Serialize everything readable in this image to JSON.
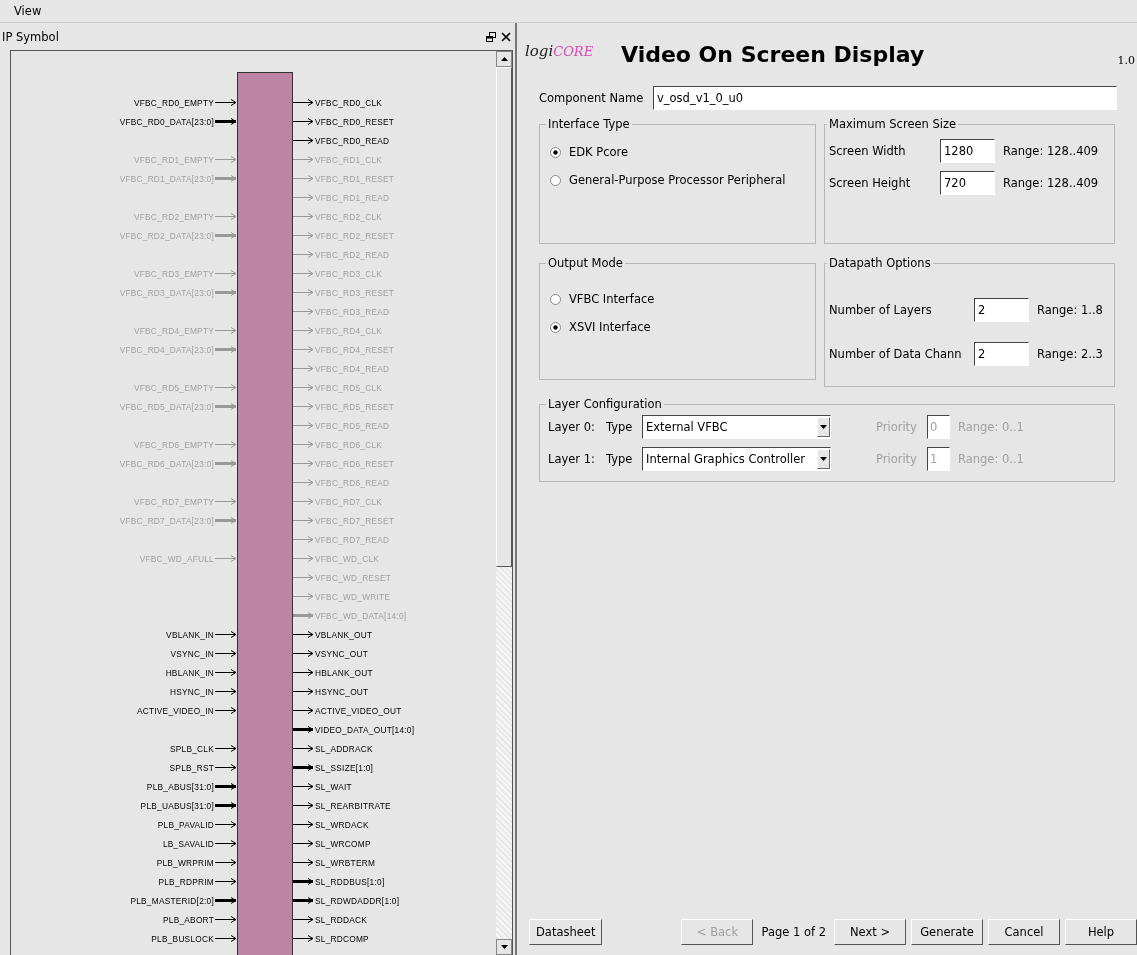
{
  "menu": [
    {
      "label": "View"
    }
  ],
  "symbol_panel": {
    "title": "IP Symbol",
    "rows": [
      {
        "left": {
          "name": "VFBC_RD0_EMPTY",
          "bus": false,
          "enabled": true
        },
        "right": {
          "name": "VFBC_RD0_CLK",
          "bus": false,
          "enabled": true
        }
      },
      {
        "left": {
          "name": "VFBC_RD0_DATA[23:0]",
          "bus": true,
          "enabled": true
        },
        "right": {
          "name": "VFBC_RD0_RESET",
          "bus": false,
          "enabled": true
        }
      },
      {
        "right": {
          "name": "VFBC_RD0_READ",
          "bus": false,
          "enabled": true
        }
      },
      {
        "left": {
          "name": "VFBC_RD1_EMPTY",
          "bus": false,
          "enabled": false
        },
        "right": {
          "name": "VFBC_RD1_CLK",
          "bus": false,
          "enabled": false
        }
      },
      {
        "left": {
          "name": "VFBC_RD1_DATA[23:0]",
          "bus": true,
          "enabled": false
        },
        "right": {
          "name": "VFBC_RD1_RESET",
          "bus": false,
          "enabled": false
        }
      },
      {
        "right": {
          "name": "VFBC_RD1_READ",
          "bus": false,
          "enabled": false
        }
      },
      {
        "left": {
          "name": "VFBC_RD2_EMPTY",
          "bus": false,
          "enabled": false
        },
        "right": {
          "name": "VFBC_RD2_CLK",
          "bus": false,
          "enabled": false
        }
      },
      {
        "left": {
          "name": "VFBC_RD2_DATA[23:0]",
          "bus": true,
          "enabled": false
        },
        "right": {
          "name": "VFBC_RD2_RESET",
          "bus": false,
          "enabled": false
        }
      },
      {
        "right": {
          "name": "VFBC_RD2_READ",
          "bus": false,
          "enabled": false
        }
      },
      {
        "left": {
          "name": "VFBC_RD3_EMPTY",
          "bus": false,
          "enabled": false
        },
        "right": {
          "name": "VFBC_RD3_CLK",
          "bus": false,
          "enabled": false
        }
      },
      {
        "left": {
          "name": "VFBC_RD3_DATA[23:0]",
          "bus": true,
          "enabled": false
        },
        "right": {
          "name": "VFBC_RD3_RESET",
          "bus": false,
          "enabled": false
        }
      },
      {
        "right": {
          "name": "VFBC_RD3_READ",
          "bus": false,
          "enabled": false
        }
      },
      {
        "left": {
          "name": "VFBC_RD4_EMPTY",
          "bus": false,
          "enabled": false
        },
        "right": {
          "name": "VFBC_RD4_CLK",
          "bus": false,
          "enabled": false
        }
      },
      {
        "left": {
          "name": "VFBC_RD4_DATA[23:0]",
          "bus": true,
          "enabled": false
        },
        "right": {
          "name": "VFBC_RD4_RESET",
          "bus": false,
          "enabled": false
        }
      },
      {
        "right": {
          "name": "VFBC_RD4_READ",
          "bus": false,
          "enabled": false
        }
      },
      {
        "left": {
          "name": "VFBC_RD5_EMPTY",
          "bus": false,
          "enabled": false
        },
        "right": {
          "name": "VFBC_RD5_CLK",
          "bus": false,
          "enabled": false
        }
      },
      {
        "left": {
          "name": "VFBC_RD5_DATA[23:0]",
          "bus": true,
          "enabled": false
        },
        "right": {
          "name": "VFBC_RD5_RESET",
          "bus": false,
          "enabled": false
        }
      },
      {
        "right": {
          "name": "VFBC_RD5_READ",
          "bus": false,
          "enabled": false
        }
      },
      {
        "left": {
          "name": "VFBC_RD6_EMPTY",
          "bus": false,
          "enabled": false
        },
        "right": {
          "name": "VFBC_RD6_CLK",
          "bus": false,
          "enabled": false
        }
      },
      {
        "left": {
          "name": "VFBC_RD6_DATA[23:0]",
          "bus": true,
          "enabled": false
        },
        "right": {
          "name": "VFBC_RD6_RESET",
          "bus": false,
          "enabled": false
        }
      },
      {
        "right": {
          "name": "VFBC_RD6_READ",
          "bus": false,
          "enabled": false
        }
      },
      {
        "left": {
          "name": "VFBC_RD7_EMPTY",
          "bus": false,
          "enabled": false
        },
        "right": {
          "name": "VFBC_RD7_CLK",
          "bus": false,
          "enabled": false
        }
      },
      {
        "left": {
          "name": "VFBC_RD7_DATA[23:0]",
          "bus": true,
          "enabled": false
        },
        "right": {
          "name": "VFBC_RD7_RESET",
          "bus": false,
          "enabled": false
        }
      },
      {
        "right": {
          "name": "VFBC_RD7_READ",
          "bus": false,
          "enabled": false
        }
      },
      {
        "left": {
          "name": "VFBC_WD_AFULL",
          "bus": false,
          "enabled": false
        },
        "right": {
          "name": "VFBC_WD_CLK",
          "bus": false,
          "enabled": false
        }
      },
      {
        "right": {
          "name": "VFBC_WD_RESET",
          "bus": false,
          "enabled": false
        }
      },
      {
        "right": {
          "name": "VFBC_WD_WRITE",
          "bus": false,
          "enabled": false
        }
      },
      {
        "right": {
          "name": "VFBC_WD_DATA[14:0]",
          "bus": true,
          "enabled": false
        }
      },
      {
        "left": {
          "name": "VBLANK_IN",
          "bus": false,
          "enabled": true
        },
        "right": {
          "name": "VBLANK_OUT",
          "bus": false,
          "enabled": true
        }
      },
      {
        "left": {
          "name": "VSYNC_IN",
          "bus": false,
          "enabled": true
        },
        "right": {
          "name": "VSYNC_OUT",
          "bus": false,
          "enabled": true
        }
      },
      {
        "left": {
          "name": "HBLANK_IN",
          "bus": false,
          "enabled": true
        },
        "right": {
          "name": "HBLANK_OUT",
          "bus": false,
          "enabled": true
        }
      },
      {
        "left": {
          "name": "HSYNC_IN",
          "bus": false,
          "enabled": true
        },
        "right": {
          "name": "HSYNC_OUT",
          "bus": false,
          "enabled": true
        }
      },
      {
        "left": {
          "name": "ACTIVE_VIDEO_IN",
          "bus": false,
          "enabled": true
        },
        "right": {
          "name": "ACTIVE_VIDEO_OUT",
          "bus": false,
          "enabled": true
        }
      },
      {
        "right": {
          "name": "VIDEO_DATA_OUT[14:0]",
          "bus": true,
          "enabled": true
        }
      },
      {
        "left": {
          "name": "SPLB_CLK",
          "bus": false,
          "enabled": true
        },
        "right": {
          "name": "SL_ADDRACK",
          "bus": false,
          "enabled": true
        }
      },
      {
        "left": {
          "name": "SPLB_RST",
          "bus": false,
          "enabled": true
        },
        "right": {
          "name": "SL_SSIZE[1:0]",
          "bus": true,
          "enabled": true
        }
      },
      {
        "left": {
          "name": "PLB_ABUS[31:0]",
          "bus": true,
          "enabled": true
        },
        "right": {
          "name": "SL_WAIT",
          "bus": false,
          "enabled": true
        }
      },
      {
        "left": {
          "name": "PLB_UABUS[31:0]",
          "bus": true,
          "enabled": true
        },
        "right": {
          "name": "SL_REARBITRATE",
          "bus": false,
          "enabled": true
        }
      },
      {
        "left": {
          "name": "PLB_PAVALID",
          "bus": false,
          "enabled": true
        },
        "right": {
          "name": "SL_WRDACK",
          "bus": false,
          "enabled": true
        }
      },
      {
        "left": {
          "name": "LB_SAVALID",
          "bus": false,
          "enabled": true
        },
        "right": {
          "name": "SL_WRCOMP",
          "bus": false,
          "enabled": true
        }
      },
      {
        "left": {
          "name": "PLB_WRPRIM",
          "bus": false,
          "enabled": true
        },
        "right": {
          "name": "SL_WRBTERM",
          "bus": false,
          "enabled": true
        }
      },
      {
        "left": {
          "name": "PLB_RDPRIM",
          "bus": false,
          "enabled": true
        },
        "right": {
          "name": "SL_RDDBUS[1:0]",
          "bus": true,
          "enabled": true
        }
      },
      {
        "left": {
          "name": "PLB_MASTERID[2:0]",
          "bus": true,
          "enabled": true
        },
        "right": {
          "name": "SL_RDWDADDR[1:0]",
          "bus": true,
          "enabled": true
        }
      },
      {
        "left": {
          "name": "PLB_ABORT",
          "bus": false,
          "enabled": true
        },
        "right": {
          "name": "SL_RDDACK",
          "bus": false,
          "enabled": true
        }
      },
      {
        "left": {
          "name": "PLB_BUSLOCK",
          "bus": false,
          "enabled": true
        },
        "right": {
          "name": "SL_RDCOMP",
          "bus": false,
          "enabled": true
        }
      }
    ]
  },
  "wizard": {
    "logo": {
      "dark_part": "logi",
      "light_part": "CORE"
    },
    "title": "Video On Screen Display",
    "version": "1.0",
    "component_name": {
      "label": "Component Name",
      "value": "v_osd_v1_0_u0"
    },
    "groups": [
      {
        "kind": "radios",
        "title": "Interface Type",
        "options": [
          {
            "label": "EDK Pcore",
            "selected": true
          },
          {
            "label": "General-Purpose Processor Peripheral",
            "selected": false
          }
        ]
      },
      {
        "kind": "fields",
        "title": "Maximum Screen Size",
        "fields": [
          {
            "label": "Screen Width",
            "value": "1280",
            "range": "Range: 128..409"
          },
          {
            "label": "Screen Height",
            "value": "720",
            "range": "Range: 128..409"
          }
        ]
      },
      {
        "kind": "radios",
        "title": "Output Mode",
        "options": [
          {
            "label": "VFBC Interface",
            "selected": false
          },
          {
            "label": "XSVI Interface",
            "selected": true
          }
        ]
      },
      {
        "kind": "fields",
        "title": "Datapath Options",
        "fields": [
          {
            "label": "Number of Layers",
            "value": "2",
            "range": "Range: 1..8"
          },
          {
            "label": "Number of Data Chann",
            "value": "2",
            "range": "Range: 2..3"
          }
        ]
      },
      {
        "kind": "layers",
        "title": "Layer Configuration",
        "layers": [
          {
            "label": "Layer 0:",
            "type_label": "Type",
            "type_value": "External VFBC",
            "priority_label": "Priority",
            "priority_value": "0",
            "range": "Range: 0..1",
            "priority_disabled": true
          },
          {
            "label": "Layer 1:",
            "type_label": "Type",
            "type_value": "Internal Graphics Controller",
            "priority_label": "Priority",
            "priority_value": "1",
            "range": "Range: 0..1",
            "priority_disabled": true
          }
        ]
      }
    ],
    "footer": {
      "left_buttons": [
        {
          "label": "Datasheet",
          "disabled": false
        }
      ],
      "right_items": [
        {
          "kind": "button",
          "label": "< Back",
          "disabled": true
        },
        {
          "kind": "text",
          "label": "Page 1 of 2"
        },
        {
          "kind": "button",
          "label": "Next >",
          "disabled": false
        },
        {
          "kind": "button",
          "label": "Generate",
          "disabled": false
        },
        {
          "kind": "button",
          "label": "Cancel",
          "disabled": false
        },
        {
          "kind": "button",
          "label": "Help",
          "disabled": false
        }
      ]
    }
  }
}
